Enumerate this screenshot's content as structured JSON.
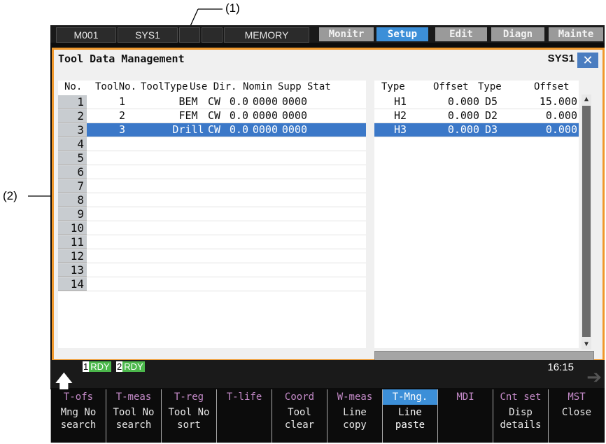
{
  "callouts": {
    "c1": "(1)",
    "c2": "(2)"
  },
  "topbar": {
    "program": "M001",
    "system": "SYS1",
    "memory": "MEMORY",
    "tabs": [
      "Monitr",
      "Setup",
      "Edit",
      "Diagn",
      "Mainte"
    ],
    "active_tab": "Setup"
  },
  "window": {
    "title": "Tool Data Management",
    "system": "SYS1",
    "close": "✕"
  },
  "left_table": {
    "headers": [
      "No.",
      "ToolNo.",
      "ToolType",
      "Use Dir.",
      "Nomin",
      "Supp",
      "Stat"
    ],
    "rows": [
      {
        "no": "1",
        "toolno": "1",
        "type": "BEM",
        "dir": "CW",
        "nomin": "0.0",
        "supp": "0000",
        "stat": "0000"
      },
      {
        "no": "2",
        "toolno": "2",
        "type": "FEM",
        "dir": "CW",
        "nomin": "0.0",
        "supp": "0000",
        "stat": "0000"
      },
      {
        "no": "3",
        "toolno": "3",
        "type": "Drill",
        "dir": "CW",
        "nomin": "0.0",
        "supp": "0000",
        "stat": "0000"
      },
      {
        "no": "4"
      },
      {
        "no": "5"
      },
      {
        "no": "6"
      },
      {
        "no": "7"
      },
      {
        "no": "8"
      },
      {
        "no": "9"
      },
      {
        "no": "10"
      },
      {
        "no": "11"
      },
      {
        "no": "12"
      },
      {
        "no": "13"
      },
      {
        "no": "14"
      }
    ],
    "selected_row": 3
  },
  "right_table": {
    "headers": [
      "Type",
      "Offset",
      "Type",
      "Offset"
    ],
    "rows": [
      {
        "t1": "H1",
        "o1": "0.000",
        "t2": "D5",
        "o2": "15.000"
      },
      {
        "t1": "H2",
        "o1": "0.000",
        "t2": "D2",
        "o2": "0.000"
      },
      {
        "t1": "H3",
        "o1": "0.000",
        "t2": "D3",
        "o2": "0.000"
      }
    ]
  },
  "status": {
    "rdy1_num": "1",
    "rdy1": "RDY",
    "rdy2_num": "2",
    "rdy2": "RDY",
    "time": "16:15"
  },
  "menu_keys": [
    {
      "top": "T-ofs",
      "bottom": "Mng No\nsearch"
    },
    {
      "top": "T-meas",
      "bottom": "Tool No\nsearch"
    },
    {
      "top": "T-reg",
      "bottom": "Tool No\nsort"
    },
    {
      "top": "T-life",
      "bottom": ""
    },
    {
      "top": "Coord",
      "bottom": "Tool\nclear"
    },
    {
      "top": "W-meas",
      "bottom": "Line\ncopy"
    },
    {
      "top": "T-Mng.",
      "bottom": "Line\npaste"
    },
    {
      "top": "MDI",
      "bottom": ""
    },
    {
      "top": "Cnt set",
      "bottom": "Disp\ndetails"
    },
    {
      "top": "MST",
      "bottom": "Close"
    }
  ],
  "colors": {
    "accent": "#3c8fd8",
    "frame": "#f0982c",
    "selection": "#3b78c8",
    "ready": "#4cb84c"
  }
}
